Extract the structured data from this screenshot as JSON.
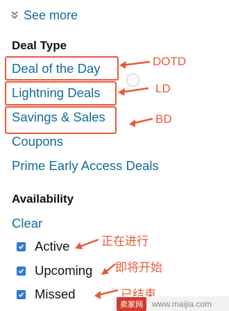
{
  "see_more": {
    "label": "See more",
    "icon": "double-chevron-down-icon"
  },
  "deal_type": {
    "title": "Deal Type",
    "items": [
      {
        "label": "Deal of the Day",
        "annotation": "DOTD",
        "highlighted": true
      },
      {
        "label": "Lightning Deals",
        "annotation": "LD",
        "highlighted": true
      },
      {
        "label": "Savings & Sales",
        "annotation": "BD",
        "highlighted": true
      },
      {
        "label": "Coupons",
        "highlighted": false
      },
      {
        "label": "Prime Early Access Deals",
        "highlighted": false
      }
    ]
  },
  "availability": {
    "title": "Availability",
    "clear_label": "Clear",
    "options": [
      {
        "label": "Active",
        "checked": true,
        "annotation": "正在进行"
      },
      {
        "label": "Upcoming",
        "checked": true,
        "annotation": "即将开始"
      },
      {
        "label": "Missed",
        "checked": true,
        "annotation": "已结束"
      }
    ]
  },
  "watermark": {
    "badge": "卖家网",
    "url": "www.maijia.com"
  },
  "colors": {
    "link": "#0f6b9b",
    "annotation": "#e8583a",
    "checkbox": "#2f80d8"
  }
}
